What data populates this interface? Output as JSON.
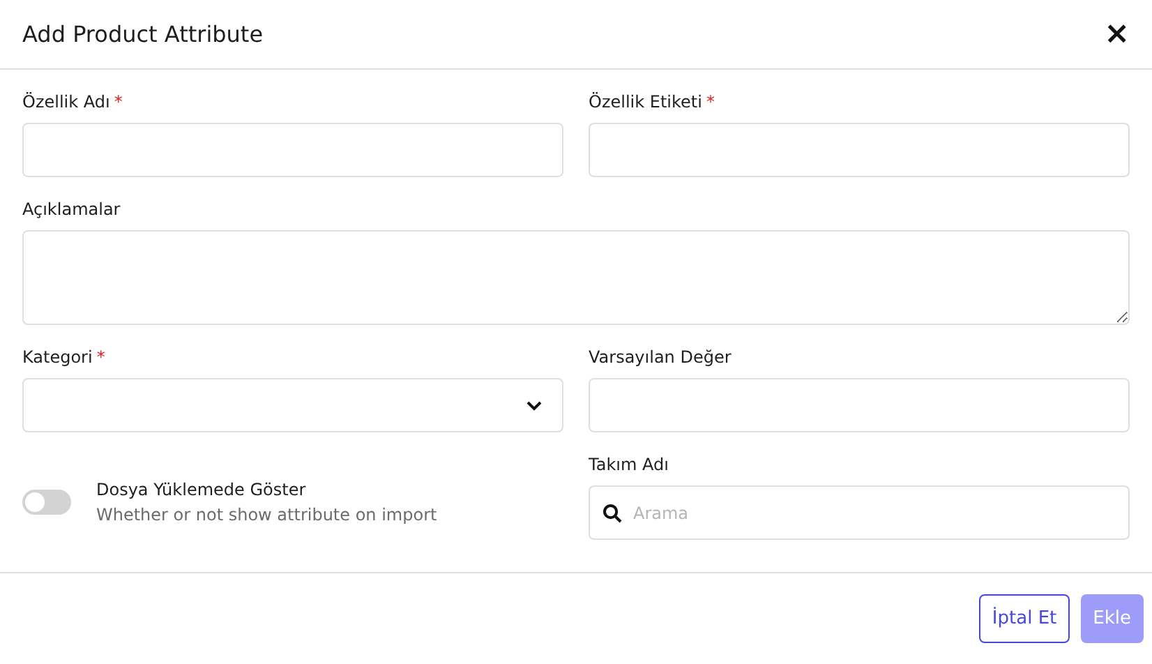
{
  "dialog": {
    "title": "Add Product Attribute",
    "close": "×"
  },
  "fields": [
    {
      "kind": "input",
      "label": "Özellik Adı",
      "required_mark": "*"
    },
    {
      "kind": "input",
      "label": "Özellik Etiketi",
      "required_mark": "*"
    },
    {
      "kind": "textarea",
      "label": "Açıklamalar"
    },
    {
      "kind": "select",
      "label": "Kategori",
      "required_mark": "*"
    },
    {
      "kind": "input",
      "label": "Varsayılan Değer"
    },
    {
      "kind": "toggle",
      "label": "Dosya Yüklemede Göster",
      "description": "Whether or not show attribute on import",
      "on": false
    },
    {
      "kind": "search",
      "label": "Takım Adı",
      "placeholder": "Arama"
    }
  ],
  "buttons": [
    {
      "label": "İptal Et",
      "kind": "secondary",
      "disabled": false
    },
    {
      "label": "Ekle",
      "kind": "primary",
      "disabled": true
    }
  ]
}
